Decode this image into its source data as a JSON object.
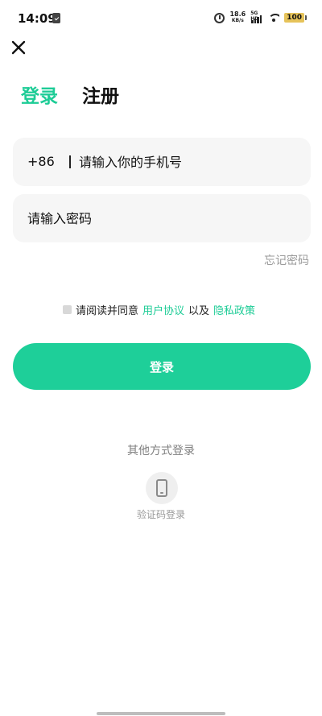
{
  "status_bar": {
    "time": "14:09",
    "net_speed_value": "18.6",
    "net_speed_unit": "KB/s",
    "network_type": "5G HD",
    "battery": "100"
  },
  "tabs": {
    "login": "登录",
    "register": "注册",
    "active": "login"
  },
  "phone_field": {
    "country_code": "+86",
    "placeholder": "请输入你的手机号"
  },
  "password_field": {
    "placeholder": "请输入密码"
  },
  "forgot_password": "忘记密码",
  "agreement": {
    "checked": false,
    "prefix": "请阅读并同意",
    "user_agreement": "用户协议",
    "connector": "以及",
    "privacy_policy": "隐私政策"
  },
  "login_button": "登录",
  "other_methods": {
    "title": "其他方式登录",
    "sms_login_label": "验证码登录",
    "sms_icon": "phone-icon"
  },
  "colors": {
    "accent": "#1dcc96",
    "button": "#1ecf99",
    "field_background": "#f6f6f6"
  }
}
